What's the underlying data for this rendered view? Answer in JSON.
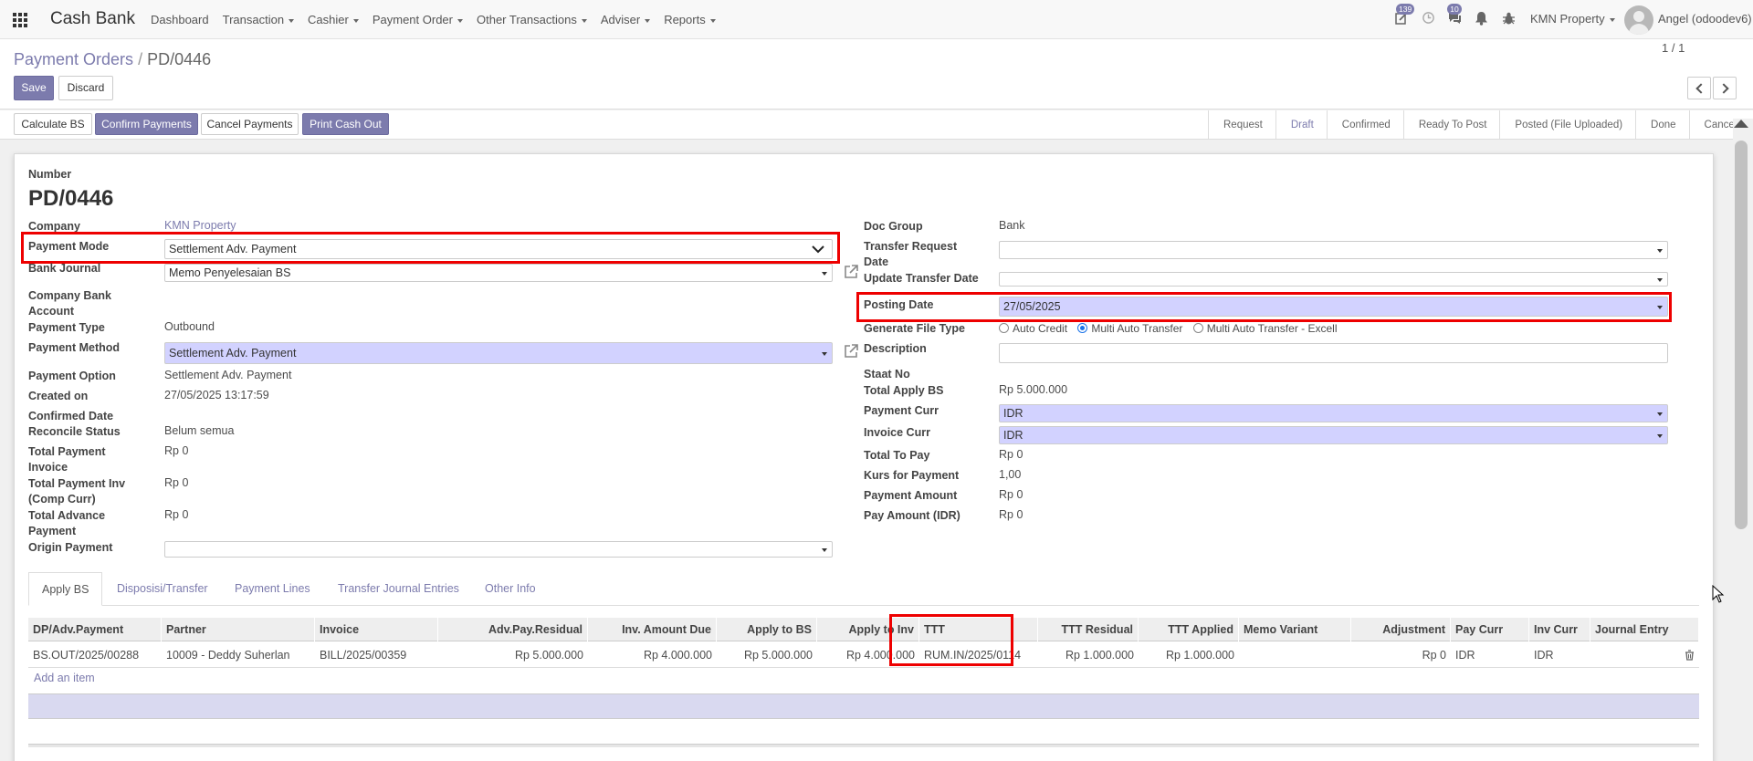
{
  "navbar": {
    "brand": "Cash Bank",
    "menus": [
      "Dashboard",
      "Transaction",
      "Cashier",
      "Payment Order",
      "Other Transactions",
      "Adviser",
      "Reports"
    ],
    "activity_badge": "139",
    "messages_badge": "10",
    "company": "KMN Property",
    "user": "Angel (odoodev6)"
  },
  "control_panel": {
    "breadcrumb_parent": "Payment Orders",
    "breadcrumb_sep": "/",
    "breadcrumb_current": "PD/0446",
    "save_label": "Save",
    "discard_label": "Discard",
    "pager": "1 / 1"
  },
  "actions": {
    "calculate": "Calculate BS",
    "confirm": "Confirm Payments",
    "cancel": "Cancel Payments",
    "print": "Print Cash Out"
  },
  "stages": [
    "Request",
    "Draft",
    "Confirmed",
    "Ready To Post",
    "Posted (File Uploaded)",
    "Done",
    "Cancel"
  ],
  "form": {
    "number_label": "Number",
    "number": "PD/0446",
    "left": {
      "company_label": "Company",
      "company": "KMN Property",
      "payment_mode_label": "Payment Mode",
      "payment_mode": "Settlement Adv. Payment",
      "bank_journal_label": "Bank Journal",
      "bank_journal": "Memo Penyelesaian BS",
      "company_bank_label": "Company Bank Account",
      "payment_type_label": "Payment Type",
      "payment_type": "Outbound",
      "payment_method_label": "Payment Method",
      "payment_method": "Settlement Adv. Payment",
      "payment_option_label": "Payment Option",
      "payment_option": "Settlement Adv. Payment",
      "created_on_label": "Created on",
      "created_on": "27/05/2025 13:17:59",
      "confirmed_date_label": "Confirmed Date",
      "reconcile_label": "Reconcile Status",
      "reconcile": "Belum semua",
      "total_payment_invoice_label": "Total Payment Invoice",
      "total_payment_invoice": "Rp 0",
      "total_payment_inv_comp_label": "Total Payment Inv (Comp Curr)",
      "total_payment_inv_comp": "Rp 0",
      "total_advance_label": "Total Advance Payment",
      "total_advance": "Rp 0",
      "origin_payment_label": "Origin Payment"
    },
    "right": {
      "doc_group_label": "Doc Group",
      "doc_group": "Bank",
      "transfer_request_label": "Transfer Request Date",
      "update_transfer_label": "Update Transfer Date",
      "posting_date_label": "Posting Date",
      "posting_date": "27/05/2025",
      "generate_file_label": "Generate File Type",
      "gen_opt1": "Auto Credit",
      "gen_opt2": "Multi Auto Transfer",
      "gen_opt3": "Multi Auto Transfer - Excell",
      "description_label": "Description",
      "staat_label": "Staat No",
      "total_apply_label": "Total Apply BS",
      "total_apply": "Rp 5.000.000",
      "payment_curr_label": "Payment Curr",
      "payment_curr": "IDR",
      "invoice_curr_label": "Invoice Curr",
      "invoice_curr": "IDR",
      "total_to_pay_label": "Total To Pay",
      "total_to_pay": "Rp 0",
      "kurs_label": "Kurs for Payment",
      "kurs": "1,00",
      "payment_amount_label": "Payment Amount",
      "payment_amount": "Rp 0",
      "pay_amount_idr_label": "Pay Amount (IDR)",
      "pay_amount_idr": "Rp 0"
    }
  },
  "tabs": [
    "Apply BS",
    "Disposisi/Transfer",
    "Payment Lines",
    "Transfer Journal Entries",
    "Other Info"
  ],
  "table": {
    "headers": [
      "DP/Adv.Payment",
      "Partner",
      "Invoice",
      "Adv.Pay.Residual",
      "Inv. Amount Due",
      "Apply to BS",
      "Apply to Inv",
      "TTT",
      "TTT Residual",
      "TTT Applied",
      "Memo Variant",
      "Adjustment",
      "Pay Curr",
      "Inv Curr",
      "Journal Entry"
    ],
    "rows": [
      [
        "BS.OUT/2025/00288",
        "10009 - Deddy Suherlan",
        "BILL/2025/00359",
        "Rp 5.000.000",
        "Rp 4.000.000",
        "Rp 5.000.000",
        "Rp 4.000.000",
        "RUM.IN/2025/0114",
        "Rp 1.000.000",
        "Rp 1.000.000",
        "",
        "Rp 0",
        "IDR",
        "IDR",
        ""
      ]
    ],
    "add_item": "Add an item"
  },
  "colors": {
    "accent": "#7c7bad",
    "highlight": "#e00000",
    "required_field": "#d2d2ff"
  }
}
